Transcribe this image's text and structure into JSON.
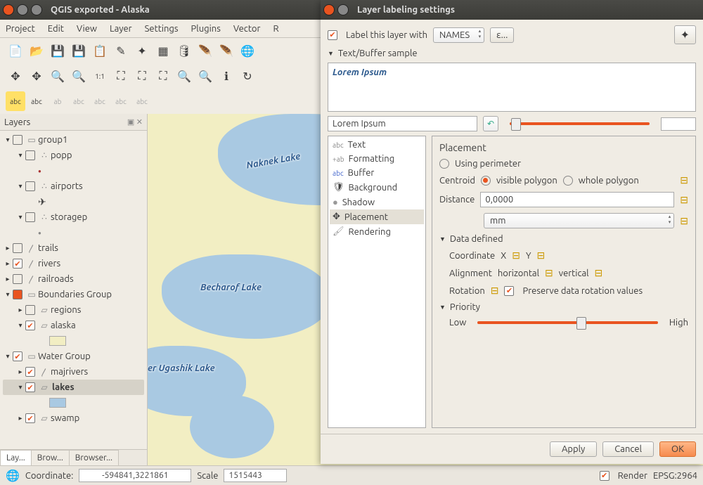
{
  "window": {
    "title": "QGIS exported - Alaska"
  },
  "menu": [
    "Project",
    "Edit",
    "View",
    "Layer",
    "Settings",
    "Plugins",
    "Vector",
    "R"
  ],
  "layersPanel": {
    "title": "Layers"
  },
  "tree": {
    "group1": "group1",
    "popp": "popp",
    "airports": "airports",
    "storagep": "storagep",
    "trails": "trails",
    "rivers": "rivers",
    "railroads": "railroads",
    "boundaries": "Boundaries Group",
    "regions": "regions",
    "alaska": "alaska",
    "water": "Water Group",
    "majrivers": "majrivers",
    "lakes": "lakes",
    "swamp": "swamp"
  },
  "bottomTabs": {
    "layers": "Lay...",
    "browser": "Brow...",
    "browser2": "Browser..."
  },
  "mapLabels": {
    "naknek": "Naknek Lake",
    "becharof": "Becharof Lake",
    "ugashik": "er Ugashik Lake"
  },
  "status": {
    "coord_label": "Coordinate:",
    "coord": "-594841,3221861",
    "scale_label": "Scale",
    "scale": "1515443",
    "render": "Render",
    "epsg": "EPSG:2964"
  },
  "dialog": {
    "title": "Layer labeling settings",
    "labelThis": "Label this layer with",
    "fieldCombo": "NAMES",
    "expr": "ε...",
    "sampleHeader": "Text/Buffer sample",
    "sampleText": "Lorem Ipsum",
    "sampleEdit": "Lorem Ipsum",
    "opts": {
      "text": "Text",
      "formatting": "Formatting",
      "buffer": "Buffer",
      "background": "Background",
      "shadow": "Shadow",
      "placement": "Placement",
      "rendering": "Rendering"
    },
    "placement": {
      "title": "Placement",
      "usingPerimeter": "Using perimeter",
      "centroid": "Centroid",
      "visible": "visible polygon",
      "whole": "whole polygon",
      "distance": "Distance",
      "distVal": "0,0000",
      "unit": "mm",
      "dataDefined": "Data defined",
      "coordinate": "Coordinate",
      "x": "X",
      "y": "Y",
      "alignment": "Alignment",
      "horizontal": "horizontal",
      "vertical": "vertical",
      "rotation": "Rotation",
      "preserve": "Preserve data rotation values",
      "priority": "Priority",
      "low": "Low",
      "high": "High"
    },
    "buttons": {
      "apply": "Apply",
      "cancel": "Cancel",
      "ok": "OK"
    }
  }
}
